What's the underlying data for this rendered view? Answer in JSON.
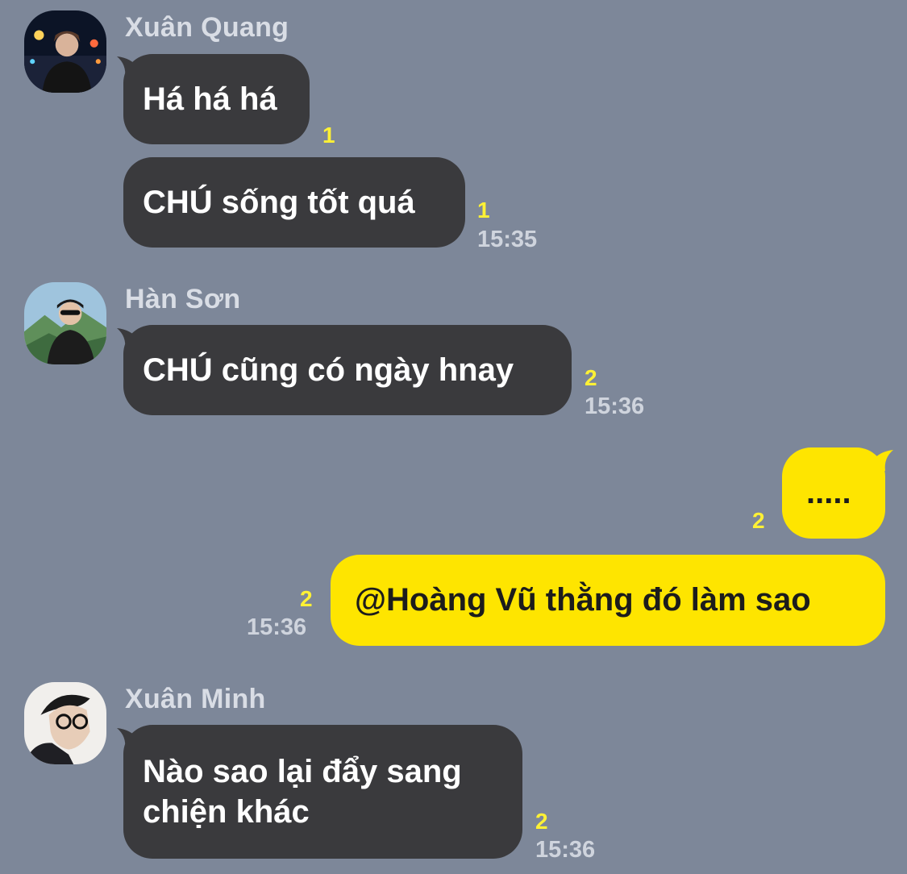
{
  "colors": {
    "background": "#7d8799",
    "incoming_bubble": "#3a3a3d",
    "outgoing_bubble": "#fee500",
    "unread_count": "#fff135",
    "meta_text": "#cfd4dd"
  },
  "messages": [
    {
      "sender": "Xuân Quang",
      "avatar_icon": "user-photo-avatar",
      "bubbles": [
        {
          "text": "Há há há",
          "unread": "1",
          "time": ""
        },
        {
          "text": "CHÚ sống tốt quá",
          "unread": "1",
          "time": "15:35"
        }
      ]
    },
    {
      "sender": "Hàn Sơn",
      "avatar_icon": "user-photo-avatar",
      "bubbles": [
        {
          "text": "CHÚ cũng có ngày hnay",
          "unread": "2",
          "time": "15:36"
        }
      ]
    },
    {
      "sender": "",
      "outgoing": true,
      "bubbles": [
        {
          "text": ".....",
          "unread": "2",
          "time": ""
        },
        {
          "text": "@Hoàng Vũ thằng đó làm sao",
          "unread": "2",
          "time": "15:36"
        }
      ]
    },
    {
      "sender": "Xuân Minh",
      "avatar_icon": "user-photo-avatar",
      "bubbles": [
        {
          "lines": [
            "Nào sao lại đẩy sang",
            "chiện khác"
          ],
          "unread": "2",
          "time": "15:36"
        }
      ]
    }
  ]
}
